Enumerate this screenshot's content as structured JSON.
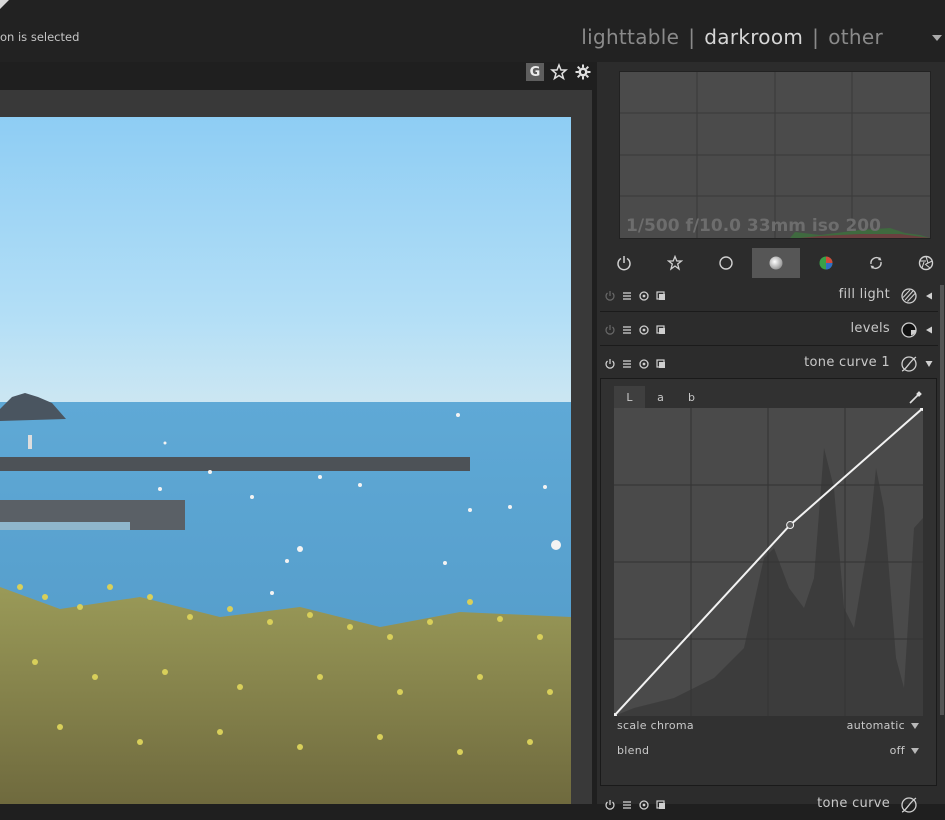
{
  "header": {
    "status_text": "on is selected",
    "views": [
      {
        "label": "lighttable",
        "active": false
      },
      {
        "label": "darkroom",
        "active": true
      },
      {
        "label": "other",
        "active": false
      }
    ],
    "separator": "|"
  },
  "view_toolbar": {
    "grouping_label": "G",
    "icons": [
      "star-icon",
      "gear-icon"
    ]
  },
  "histogram": {
    "exif": "1/500 f/10.0 33mm iso 200"
  },
  "module_groups": {
    "items": [
      {
        "icon": "power-icon",
        "active": false
      },
      {
        "icon": "favorites-star-icon",
        "active": false
      },
      {
        "icon": "basic-circle-icon",
        "active": false
      },
      {
        "icon": "tone-sphere-icon",
        "active": true
      },
      {
        "icon": "color-wheel-icon",
        "active": false
      },
      {
        "icon": "correct-arrows-icon",
        "active": false
      },
      {
        "icon": "effect-aperture-icon",
        "active": false
      }
    ]
  },
  "modules": {
    "fill_light": {
      "name": "fill light"
    },
    "levels": {
      "name": "levels"
    },
    "tone_curve": {
      "name": "tone curve 1"
    },
    "tone_curve_next": {
      "name": "tone curve"
    }
  },
  "tone_curve_panel": {
    "tabs": [
      "L",
      "a",
      "b"
    ],
    "active_tab": 0,
    "curve_points": [
      [
        0,
        0
      ],
      [
        0.57,
        0.62
      ],
      [
        1,
        1
      ]
    ],
    "scale_chroma_label": "scale chroma",
    "scale_chroma_value": "automatic",
    "blend_label": "blend",
    "blend_value": "off"
  }
}
